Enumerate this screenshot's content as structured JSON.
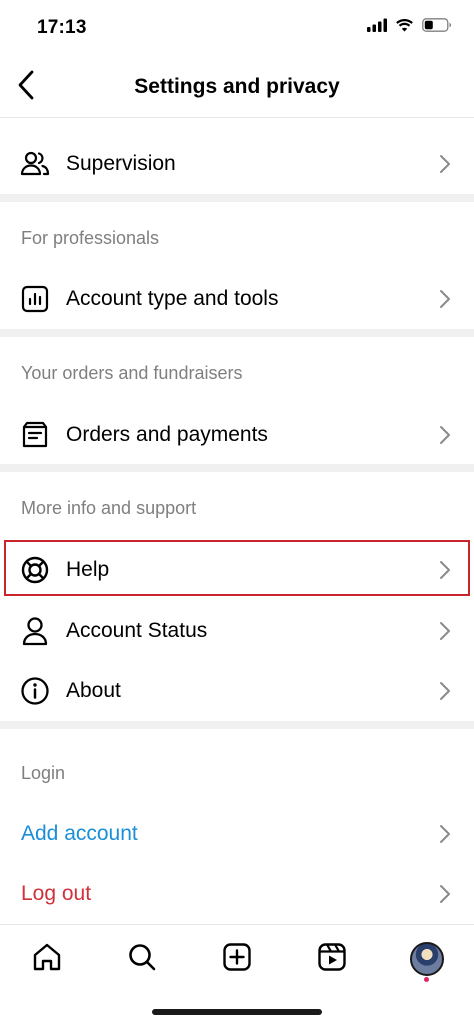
{
  "status_bar": {
    "time": "17:13",
    "icons": [
      "signal-icon",
      "wifi-icon",
      "battery-icon"
    ]
  },
  "header": {
    "title": "Settings and privacy",
    "back_icon": "back-chevron-icon"
  },
  "rows": {
    "supervision": {
      "label": "Supervision",
      "icon": "supervision-icon"
    },
    "account_type": {
      "label": "Account type and tools",
      "icon": "insights-chart-icon"
    },
    "orders": {
      "label": "Orders and payments",
      "icon": "orders-icon"
    },
    "help": {
      "label": "Help",
      "icon": "lifebuoy-icon"
    },
    "account_status": {
      "label": "Account Status",
      "icon": "person-icon"
    },
    "about": {
      "label": "About",
      "icon": "info-icon"
    },
    "add_account": {
      "label": "Add account",
      "color": "#1a8fd8"
    },
    "log_out": {
      "label": "Log out",
      "color": "#d0313a"
    }
  },
  "sections": {
    "professionals": "For professionals",
    "orders": "Your orders and fundraisers",
    "support": "More info and support",
    "login": "Login"
  },
  "colors": {
    "highlight": "#c8242b",
    "section_text": "#7f7f7f",
    "divider": "#f0f0f0"
  },
  "tab_bar": {
    "items": [
      "home-icon",
      "search-icon",
      "create-post-icon",
      "reels-icon",
      "profile-avatar"
    ],
    "has_notification": true
  }
}
